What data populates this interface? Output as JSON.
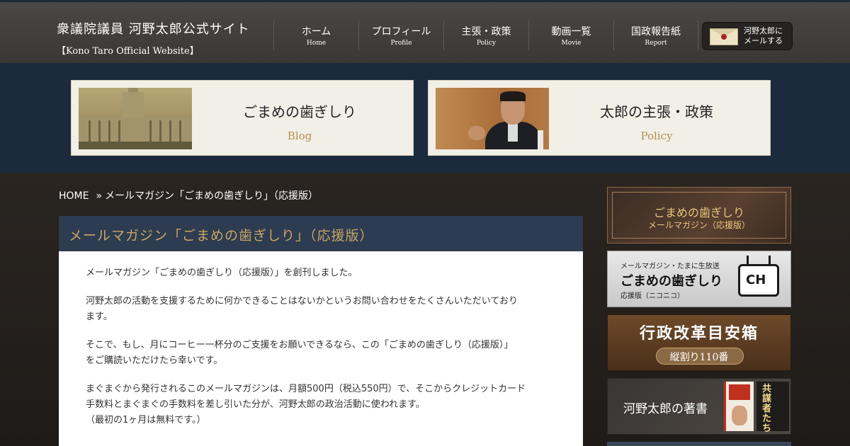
{
  "header": {
    "title": "衆議院議員 河野太郎公式サイト",
    "subtitle": "【Kono Taro Official Website】",
    "nav": [
      {
        "label": "ホーム",
        "sub": "Home"
      },
      {
        "label": "プロフィール",
        "sub": "Profile"
      },
      {
        "label": "主張・政策",
        "sub": "Policy"
      },
      {
        "label": "動画一覧",
        "sub": "Movie"
      },
      {
        "label": "国政報告紙",
        "sub": "Report"
      }
    ],
    "mail_button": {
      "line1": "河野太郎に",
      "line2": "メールする"
    }
  },
  "banners": [
    {
      "title": "ごまめの歯ぎしり",
      "sub": "Blog"
    },
    {
      "title": "太郎の主張・政策",
      "sub": "Policy"
    }
  ],
  "breadcrumb": {
    "home": "HOME",
    "separator": "»",
    "current": "メールマガジン「ごまめの歯ぎしり」（応援版）"
  },
  "article": {
    "title": "メールマガジン「ごまめの歯ぎしり」（応援版）",
    "paragraphs": [
      [
        "メールマガジン「ごまめの歯ぎしり（応援版）」を創刊しました。"
      ],
      [
        "河野太郎の活動を支援するために何かできることはないかというお問い合わせをたくさんいただいており",
        "ます。"
      ],
      [
        "そこで、もし、月にコーヒー一杯分のご支援をお願いできるなら、この「ごまめの歯ぎしり（応援版）」",
        "をご購読いただけたら幸いです。"
      ],
      [
        "まぐまぐから発行されるこのメールマガジンは、月額500円（税込550円）で、そこからクレジットカード",
        "手数料とまぐまぐの手数料を差し引いた分が、河野太郎の政治活動に使われます。",
        "（最初の1ヶ月は無料です。）"
      ]
    ]
  },
  "sidebar": {
    "magazine": {
      "title": "ごまめの歯ぎしり",
      "sub": "メールマガジン（応援版）"
    },
    "niconico": {
      "top": "メールマガジン・たまに生放送",
      "title": "ごまめの歯ぎしり",
      "sub": "応援版（ニコニコ）",
      "logo": "CH"
    },
    "reform": {
      "title": "行政改革目安箱",
      "sub": "縦割り110番"
    },
    "books": {
      "title": "河野太郎の著書",
      "book2": "共謀者たち"
    }
  },
  "colors": {
    "header_bg": "#3f3c39",
    "band_bg": "#1c2a3e",
    "accent_gold": "#c8a665",
    "card_sub": "#b29053",
    "article_head": "#2e3c51"
  }
}
